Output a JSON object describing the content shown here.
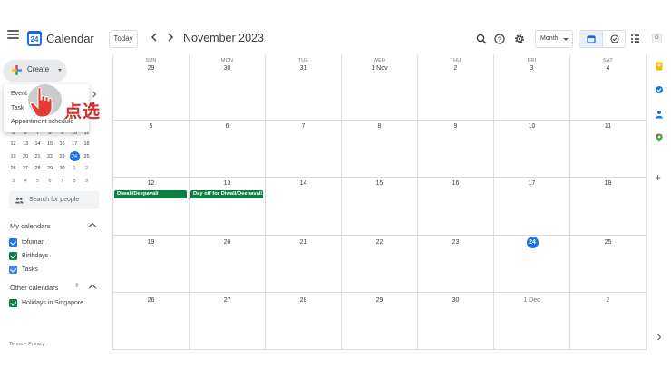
{
  "header": {
    "app_title": "Calendar",
    "logo_text": "24",
    "today_label": "Today",
    "prev_icon": "chevron-left-icon",
    "next_icon": "chevron-right-icon",
    "month_title": "November 2023",
    "view_select": "Month",
    "apps_letter": "G"
  },
  "sidebar": {
    "create_label": "Create",
    "create_menu": [
      "Event",
      "Task",
      "Appointment schedule"
    ],
    "mini_calendar": {
      "weeks": [
        [
          "5",
          "6",
          "7",
          "8",
          "9",
          "10",
          "11"
        ],
        [
          "12",
          "13",
          "14",
          "15",
          "16",
          "17",
          "18"
        ],
        [
          "19",
          "20",
          "21",
          "22",
          "23",
          "24",
          "25"
        ],
        [
          "26",
          "27",
          "28",
          "29",
          "30",
          "1",
          "2"
        ],
        [
          "3",
          "4",
          "5",
          "6",
          "7",
          "8",
          "9"
        ]
      ],
      "selected": "24"
    },
    "search_people_placeholder": "Search for people",
    "my_calendars_title": "My calendars",
    "my_calendars": [
      {
        "label": "tofuman",
        "color": "#1a73e8"
      },
      {
        "label": "Birthdays",
        "color": "#0b8043"
      },
      {
        "label": "Tasks",
        "color": "#4285f4"
      }
    ],
    "other_calendars_title": "Other calendars",
    "other_calendars": [
      {
        "label": "Holidays in Singapore",
        "color": "#0b8043"
      }
    ],
    "footer": "Terms – Privacy"
  },
  "month_grid": {
    "weekdays": [
      "SUN",
      "MON",
      "TUE",
      "WED",
      "THU",
      "FRI",
      "SAT"
    ],
    "weeks": [
      [
        "29",
        "30",
        "31",
        "1 Nov",
        "2",
        "3",
        "4"
      ],
      [
        "5",
        "6",
        "7",
        "8",
        "9",
        "10",
        "11"
      ],
      [
        "12",
        "13",
        "14",
        "15",
        "16",
        "17",
        "18"
      ],
      [
        "19",
        "20",
        "21",
        "22",
        "23",
        "24",
        "25"
      ],
      [
        "26",
        "27",
        "28",
        "29",
        "30",
        "1 Dec",
        "2"
      ]
    ],
    "today": "24",
    "events": [
      {
        "week": 2,
        "day": 0,
        "title": "Diwali/Deepavali",
        "color": "#0b8043"
      },
      {
        "week": 2,
        "day": 1,
        "title": "Day off for Diwali/Deepavali",
        "color": "#0b8043"
      }
    ]
  },
  "annotation": {
    "label": "点选"
  },
  "colors": {
    "accent": "#1a73e8",
    "holiday_green": "#0b8043",
    "annotation_red": "#d32f2f"
  }
}
